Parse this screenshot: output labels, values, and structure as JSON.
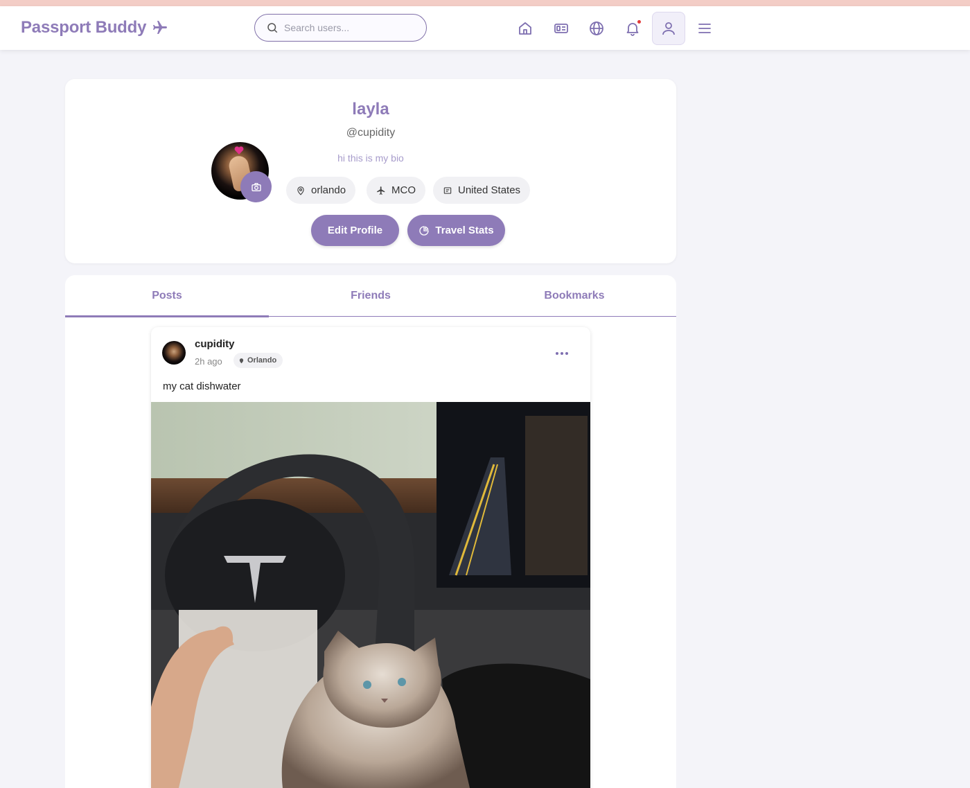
{
  "nav": {
    "brand": "Passport Buddy",
    "search_placeholder": "Search users..."
  },
  "profile": {
    "name": "layla",
    "handle": "@cupidity",
    "bio": "hi this is my bio",
    "chips": {
      "city": "orlando",
      "airport": "MCO",
      "country": "United States"
    },
    "edit_label": "Edit Profile",
    "stats_label": "Travel Stats"
  },
  "tabs": {
    "posts": "Posts",
    "friends": "Friends",
    "bookmarks": "Bookmarks"
  },
  "post": {
    "username": "cupidity",
    "time": "2h ago",
    "location": "Orlando",
    "caption": "my cat dishwater"
  },
  "colors": {
    "accent": "#8e7bb8",
    "top_strip": "#f3cdc6",
    "background": "#f4f4f9"
  }
}
